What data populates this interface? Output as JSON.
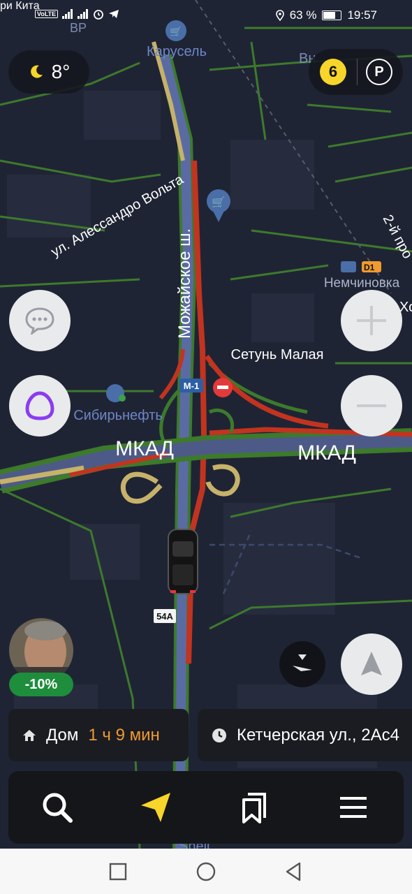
{
  "status": {
    "carrier": "ри Кита",
    "battery": "63 %",
    "time": "19:57"
  },
  "weather": {
    "temp": "8°"
  },
  "top_right": {
    "score": "6",
    "parking": "P"
  },
  "map_labels": {
    "karusel": "Карусель",
    "br": "ВР",
    "vn": "Вн",
    "alexandrovolta": "ул. Алессандро Вольта",
    "mozhayskoe": "Можайское ш.",
    "vtoroy": "2-й про",
    "d1": "D1",
    "nemchinovka": "Немчиновка",
    "kho": "Хо",
    "setun": "Сетунь Малая",
    "m1": "М-1",
    "sibneft": "Сибирьнефть",
    "mkad_left": "МКАД",
    "mkad_right": "МКАД",
    "route54a": "54А",
    "shell": "Shell"
  },
  "driver": {
    "discount": "-10%"
  },
  "destinations": [
    {
      "name": "Дом",
      "eta": "1 ч 9 мин",
      "icon": "home-icon"
    },
    {
      "name": "Кетчерская ул., 2Ас4",
      "icon": "clock-icon"
    }
  ],
  "toolbar": {
    "items": [
      "search-icon",
      "navigation-arrow-icon",
      "bookmarks-icon",
      "menu-icon"
    ]
  },
  "colors": {
    "traffic_red": "#c2341f",
    "traffic_yellow": "#c6b26a",
    "road_green": "#3d7a2c",
    "accent_orange": "#f09a2f",
    "alice_purple": "#8b3cf0"
  }
}
